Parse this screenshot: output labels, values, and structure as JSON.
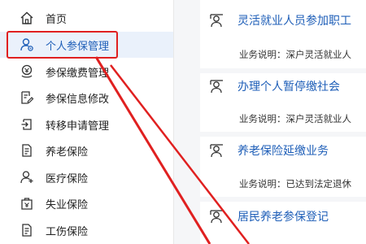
{
  "sidebar": {
    "items": [
      {
        "label": "首页",
        "icon": "home-icon"
      },
      {
        "label": "个人参保管理",
        "icon": "person-settings-icon",
        "active": true
      },
      {
        "label": "参保缴费管理",
        "icon": "payment-icon"
      },
      {
        "label": "参保信息修改",
        "icon": "edit-document-icon"
      },
      {
        "label": "转移申请管理",
        "icon": "transfer-icon"
      },
      {
        "label": "养老保险",
        "icon": "document-icon"
      },
      {
        "label": "医疗保险",
        "icon": "person-plus-icon"
      },
      {
        "label": "失业保险",
        "icon": "unemployment-icon"
      },
      {
        "label": "工伤保险",
        "icon": "document-icon"
      }
    ]
  },
  "main": {
    "cards": [
      {
        "title": "灵活就业人员参加职工",
        "desc": "业务说明：深户灵活就业人"
      },
      {
        "title": "办理个人暂停缴社会",
        "desc": "业务说明：深户灵活就业人"
      },
      {
        "title": "养老保险延缴业务",
        "desc": "业务说明：已达到法定退休"
      },
      {
        "title": "居民养老参保登记",
        "desc": ""
      }
    ]
  },
  "colors": {
    "accent": "#1f5fb8",
    "active_bg": "#eaf1fb",
    "highlight": "#e02020",
    "gap": "#f5f6f8"
  }
}
